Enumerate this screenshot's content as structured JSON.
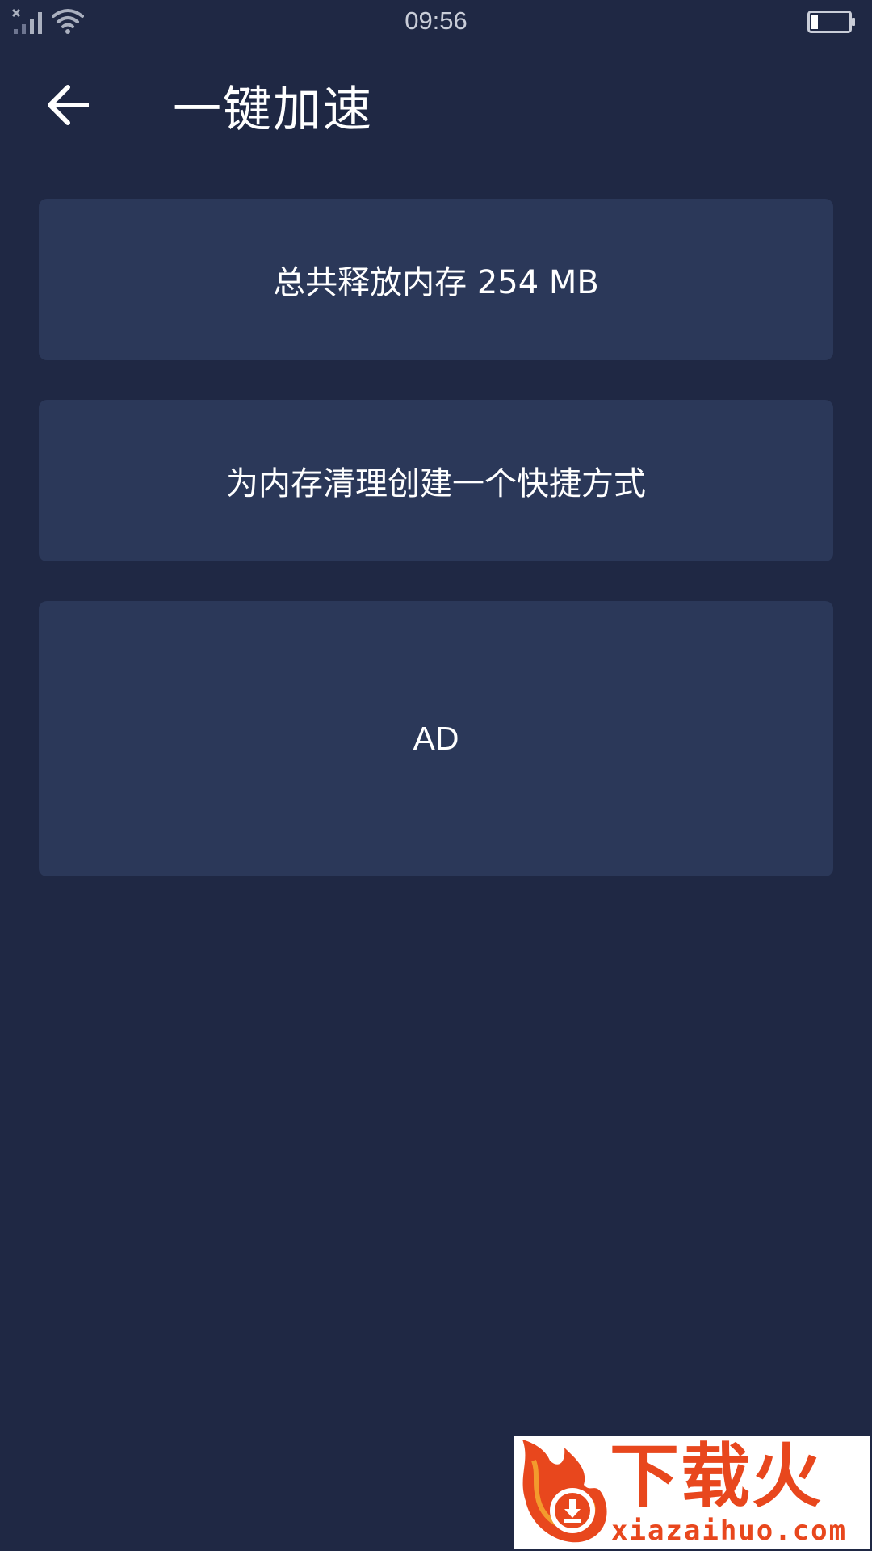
{
  "status_bar": {
    "time": "09:56",
    "icons": [
      "no-sim-signal-icon",
      "wifi-icon",
      "battery-low-icon"
    ],
    "battery_level": 0.15
  },
  "header": {
    "title": "一键加速",
    "back_icon": "back-arrow-icon"
  },
  "cards": {
    "memory_freed": "总共释放内存 254 MB",
    "shortcut": "为内存清理创建一个快捷方式",
    "ad": "AD"
  },
  "watermark": {
    "title": "下载火",
    "url": "xiazaihuo.com",
    "brand_color": "#e8471d"
  },
  "colors": {
    "background": "#1f2844",
    "card": "#2b3859",
    "text": "#ffffff"
  }
}
